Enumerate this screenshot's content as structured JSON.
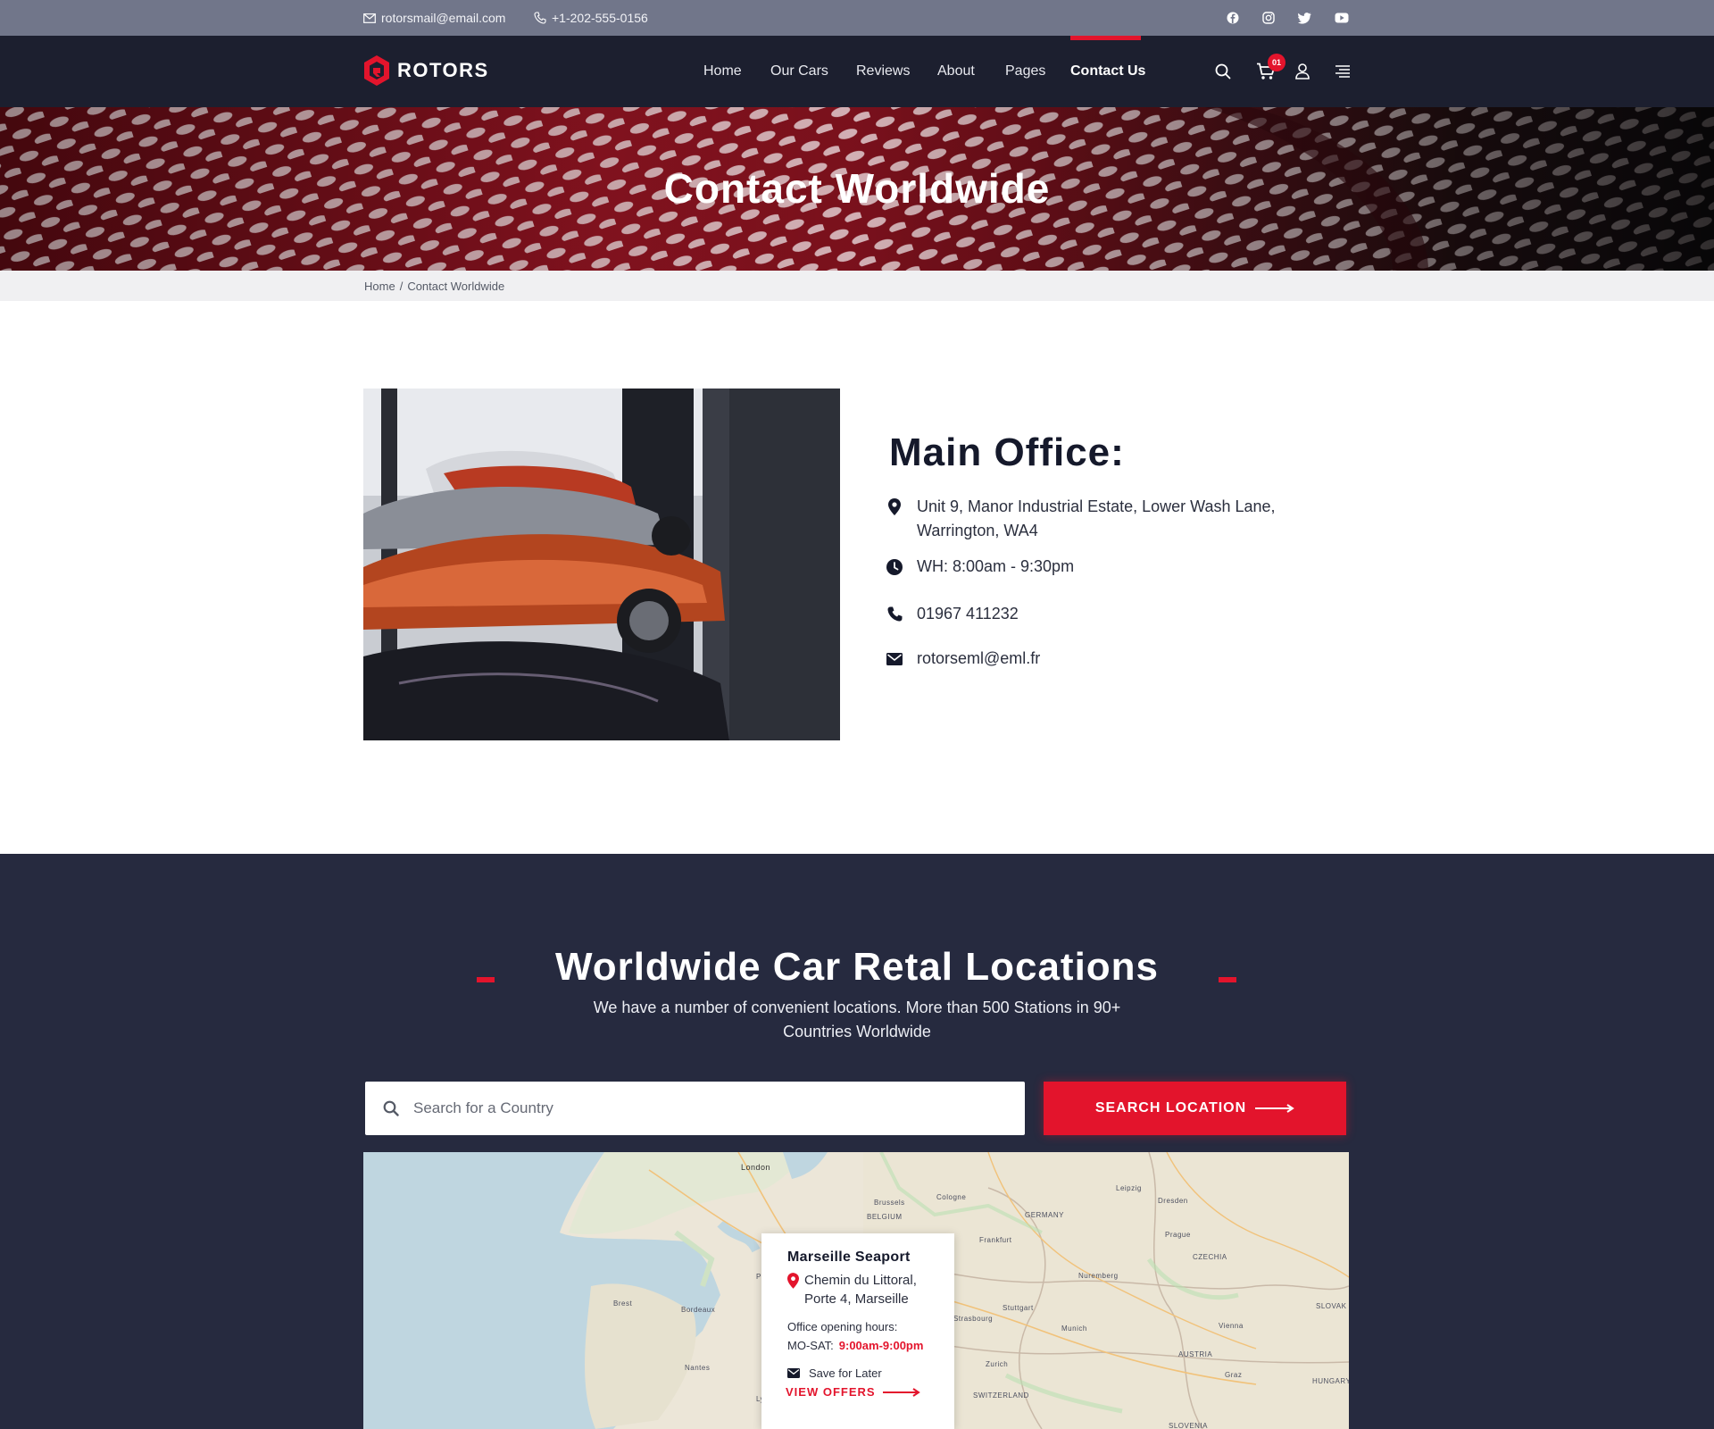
{
  "topbar": {
    "email": "rotorsmail@email.com",
    "phone": "+1-202-555-0156",
    "social": [
      "facebook-icon",
      "instagram-icon",
      "twitter-icon",
      "youtube-icon"
    ]
  },
  "nav": {
    "logo": "ROTORS",
    "items": [
      {
        "label": "Home"
      },
      {
        "label": "Our Cars"
      },
      {
        "label": "Reviews"
      },
      {
        "label": "About"
      },
      {
        "label": "Pages"
      },
      {
        "label": "Contact Us",
        "active": true
      }
    ],
    "cart_count": "01",
    "icons": [
      "search-icon",
      "cart-icon",
      "user-icon",
      "menu-icon"
    ]
  },
  "hero": {
    "title": "Contact Worldwide"
  },
  "breadcrumb": {
    "home": "Home",
    "separator": "/",
    "current": "Contact Worldwide"
  },
  "office": {
    "title": "Main Office:",
    "address_line1": "Unit 9, Manor Industrial Estate, Lower Wash Lane,",
    "address_line2": "Warrington, WA4",
    "hours": "WH: 8:00am - 9:30pm",
    "phone": "01967 411232",
    "email": "rotorseml@eml.fr"
  },
  "locations": {
    "title": "Worldwide Car Retal Locations",
    "subtitle_line1": "We have a number of convenient locations.  More than 500 Stations in 90+",
    "subtitle_line2": "Countries Worldwide",
    "search_placeholder": "Search for a Country",
    "search_button": "SEARCH LOCATION"
  },
  "map": {
    "labels": [
      "London",
      "BELGIUM",
      "GERMANY",
      "CZECHIA",
      "AUSTRIA",
      "SWITZERLAND",
      "SLOVENIA",
      "HUNGARY",
      "SLOVAK",
      "Prague",
      "Frankfurt",
      "Munich",
      "Brussels",
      "Cologne",
      "Vienna",
      "Paris",
      "Stuttgart",
      "Nuremberg",
      "Dresden",
      "Leipzig",
      "Zurich",
      "Graz",
      "Brest",
      "Nantes",
      "Bordeaux",
      "Lyon",
      "Strasbourg"
    ],
    "popup": {
      "title": "Marseille Seaport",
      "address_line1": "Chemin du Littoral,",
      "address_line2": "Porte 4, Marseille",
      "hours_label": "Office opening hours:",
      "days": "MO-SAT:",
      "times": "9:00am-9:00pm",
      "save": "Save for Later",
      "offers": "VIEW OFFERS"
    }
  },
  "colors": {
    "accent": "#e3142c",
    "dark": "#1c1f2f",
    "section": "#262a3f"
  }
}
